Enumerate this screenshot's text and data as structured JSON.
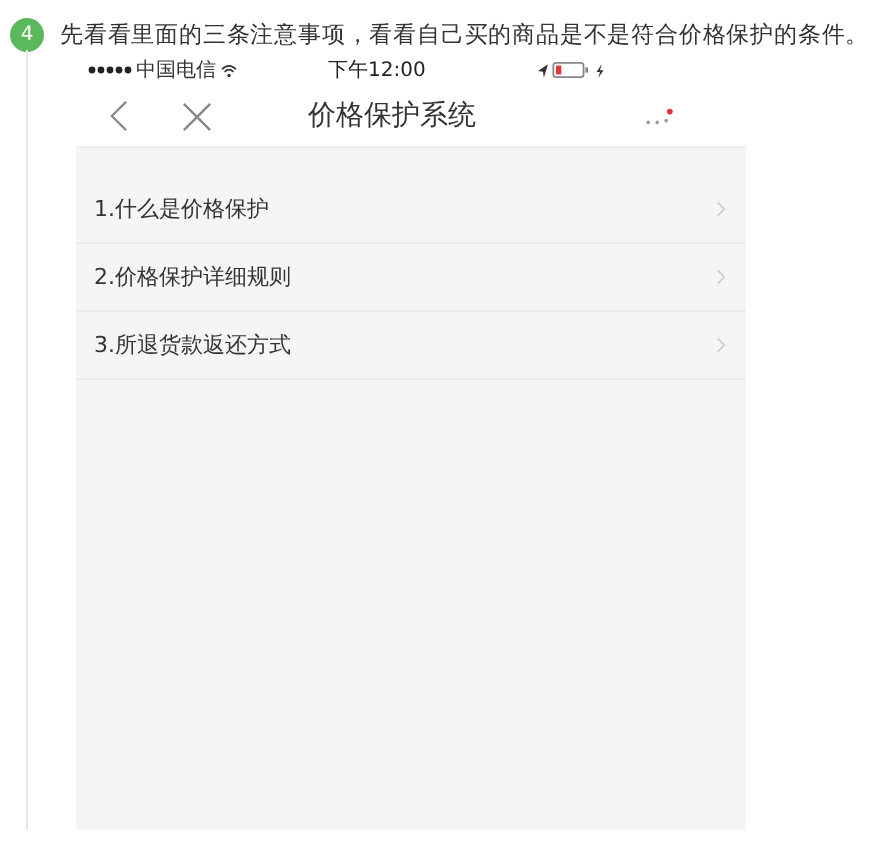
{
  "step": {
    "number": "4",
    "text": "先看看里面的三条注意事项，看看自己买的商品是不是符合价格保护的条件。"
  },
  "status_bar": {
    "carrier": "中国电信",
    "time": "下午12:00"
  },
  "nav": {
    "title": "价格保护系统"
  },
  "menu_items": [
    {
      "label": "1.什么是价格保护"
    },
    {
      "label": "2.价格保护详细规则"
    },
    {
      "label": "3.所退货款返还方式"
    }
  ]
}
